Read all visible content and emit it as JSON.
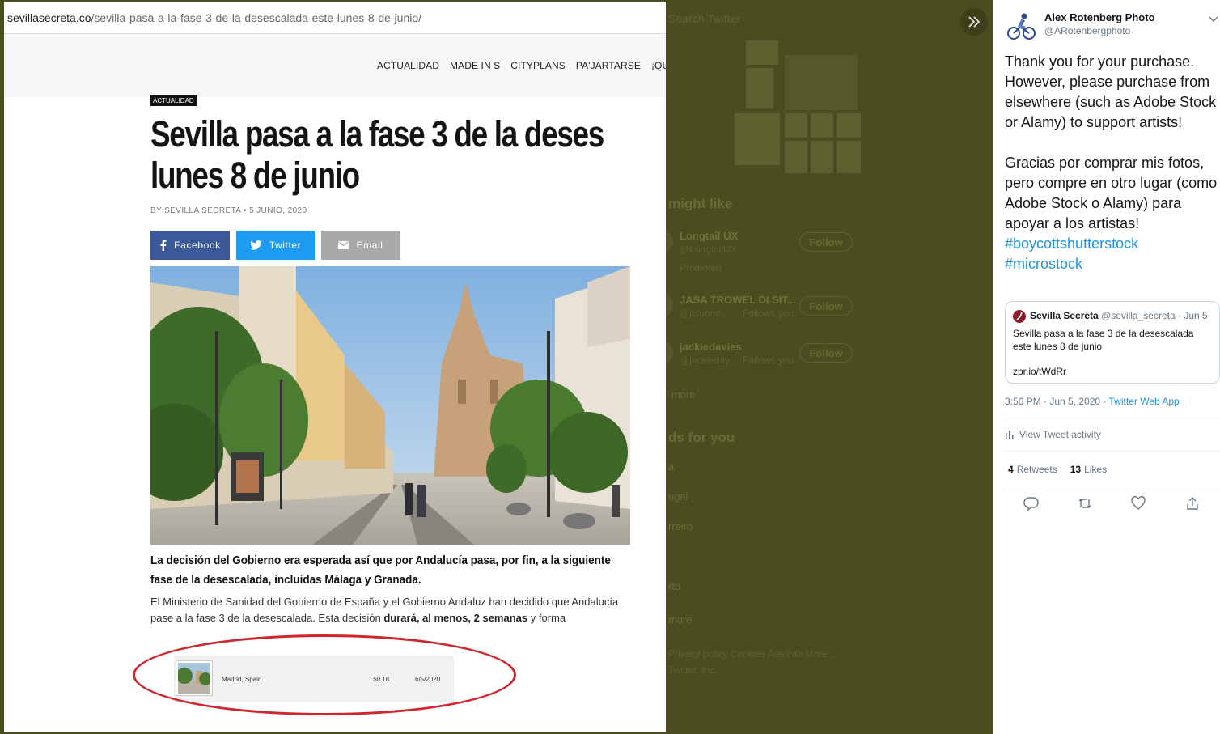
{
  "background": {
    "search_placeholder": "Search Twitter",
    "section_might_like": "might like",
    "suggestions": [
      {
        "name": "Longtail UX",
        "handle": "@LongtailUX",
        "meta": "Promoted",
        "button": "Follow"
      },
      {
        "name": "JASA TROWEL DI SIT...",
        "handle": "@jtsubon...",
        "meta": "Follows you",
        "button": "Follow"
      },
      {
        "name": "jackiedavies",
        "handle": "@jackieday...",
        "meta": "Follows you",
        "button": "Follow"
      }
    ],
    "show_more": "more",
    "section_trends": "ds for you",
    "trends": [
      "a",
      "ugal",
      "rreiro",
      "rto"
    ],
    "show_more_2": "more",
    "footer_links": "Privacy policy  Cookies  Ads info  More ...",
    "footer_copy": "Twitter, Inc."
  },
  "article": {
    "url_domain": "sevillasecreta.co",
    "url_path": "/sevilla-pasa-a-la-fase-3-de-la-desescalada-este-lunes-8-de-junio/",
    "nav": [
      "ACTUALIDAD",
      "MADE IN S",
      "CITYPLANS",
      "PA'JARTARSE",
      "¡QUÉ ARTE"
    ],
    "category": "ACTUALIDAD",
    "headline_line1": "Sevilla pasa a la fase 3 de la deses",
    "headline_line2": "lunes 8 de junio",
    "byline": "BY SEVILLA SECRETA • 5 JUNIO, 2020",
    "share": {
      "facebook": "Facebook",
      "twitter": "Twitter",
      "email": "Email"
    },
    "lede": "La decisión del Gobierno era esperada así que por Andalucía pasa, por fin, a la siguiente fase de la desescalada, incluidas Málaga y Granada.",
    "body_part1": "El Ministerio de Sanidad del Gobierno de España y el Gobierno Andaluz han decidido que Andalucía pase a la fase 3 de la desescalada. Esta decisión ",
    "body_strong": "durará, al menos, 2 semanas",
    "body_part2": " y forma",
    "sale": {
      "location": "Madrid, Spain",
      "price": "$0.18",
      "date": "6/5/2020"
    }
  },
  "tweet": {
    "author_name": "Alex Rotenberg Photo",
    "author_handle": "@ARotenbergphoto",
    "text_en": "Thank you for your purchase. However, please purchase from elsewhere (such as Adobe Stock or Alamy) to support artists!",
    "text_es": "Gracias por comprar mis fotos, pero compre en otro lugar (como Adobe Stock o Alamy) para apoyar a los artistas!",
    "hashtag1": "#boycottshutterstock",
    "hashtag2": "#microstock",
    "quote": {
      "name": "Sevilla Secreta",
      "handle": "@sevilla_secreta",
      "date": "· Jun 5",
      "text": "Sevilla pasa a la fase 3 de la desescalada este lunes 8 de junio",
      "link": "zpr.io/tWdRr"
    },
    "timestamp": "3:56 PM · Jun 5, 2020 · ",
    "app": "Twitter Web App",
    "activity": "View Tweet activity",
    "retweets_count": "4",
    "retweets_label": "Retweets",
    "likes_count": "13",
    "likes_label": "Likes"
  },
  "colors": {
    "overlay": "#4b4d21",
    "twitter_blue": "#1b95e0",
    "facebook": "#3b5998",
    "annotation_red": "#d1262e"
  },
  "icons": [
    "expand-icon",
    "facebook-icon",
    "twitter-icon",
    "email-icon",
    "chevron-down-icon",
    "analytics-icon",
    "reply-icon",
    "retweet-icon",
    "like-icon",
    "share-icon"
  ]
}
